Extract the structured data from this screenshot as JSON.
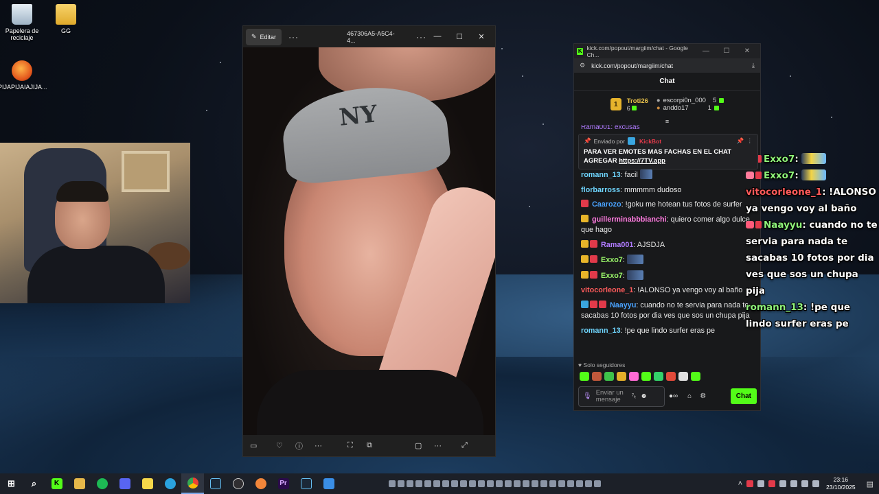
{
  "desktop": {
    "icons": [
      {
        "label": "Papelera de reciclaje",
        "icon": "recycle-bin-icon"
      },
      {
        "label": "GG",
        "icon": "folder-icon"
      },
      {
        "label": "PIJAPIJAIAJIJA...",
        "icon": "fl-studio-icon"
      }
    ]
  },
  "photos": {
    "edit_label": "Editar",
    "title": "467306A5-A5C4-4...",
    "controls": [
      "—",
      "☐",
      "✕"
    ],
    "bottom_icons": [
      "filmstrip-icon",
      "heart-icon",
      "info-icon",
      "more-icon",
      "crop-icon",
      "enhance-icon",
      "fit-icon",
      "more-icon",
      "expand-icon"
    ]
  },
  "chat_window": {
    "title": "kick.com/popout/margiim/chat - Google Ch...",
    "url": "kick.com/popout/margiim/chat",
    "header": "Chat",
    "leaderboard": {
      "first": {
        "name": "Troti26",
        "count": "6"
      },
      "second": {
        "name": "escorpi0n_000",
        "count": "5"
      },
      "third": {
        "name": "anddo17",
        "count": "1"
      }
    },
    "pinned": {
      "sent_by": "Enviado por",
      "bot": "KickBot",
      "text": "PARA VER EMOTES MAS FACHAS EN EL CHAT AGREGAR",
      "link": "https://7TV.app"
    },
    "partial_top": "Rama001: excusas",
    "messages": [
      {
        "user": "romann_13",
        "color": "#6fd6ff",
        "text": ": facil"
      },
      {
        "user": "florbarross",
        "color": "#6fd6ff",
        "text": ": mmmmm dudoso"
      },
      {
        "user": "Caarozo",
        "color": "#4aa3ff",
        "text": ": !goku me hotean tus fotos de surfer"
      },
      {
        "user": "guillerminabbbianchi",
        "color": "#ff7be0",
        "text": ": quiero comer algo dulce que hago"
      },
      {
        "user": "Rama001",
        "color": "#b07bff",
        "text": ": AJSDJA"
      },
      {
        "user": "Exxo7",
        "color": "#9bf76a",
        "text": ":"
      },
      {
        "user": "Exxo7",
        "color": "#9bf76a",
        "text": ":"
      },
      {
        "user": "vitocorleone_1",
        "color": "#ff5b5b",
        "text": ": !ALONSO ya vengo voy al baño"
      },
      {
        "user": "Naayyu",
        "color": "#4aa3ff",
        "text": ": cuando no te servia para nada te sacabas 10 fotos por dia ves que sos un chupa pija"
      },
      {
        "user": "romann_13",
        "color": "#6fd6ff",
        "text": ": !pe que lindo surfer eras pe"
      }
    ],
    "followers_only": "Solo seguidores",
    "input_placeholder": "Enviar un mensaje",
    "send_label": "Chat"
  },
  "overlay": [
    {
      "user": "Exxo7",
      "text": ":",
      "color": "#8ef27a"
    },
    {
      "user": "Exxo7",
      "text": ":",
      "color": "#8ef27a"
    },
    {
      "user": "vitocorleone_1",
      "text": ": !ALONSO ya vengo voy al baño",
      "color": "#ff5a5a"
    },
    {
      "user": "Naayyu",
      "text": ": cuando no te servia para nada te sacabas 10 fotos por dia ves que sos un chupa pija",
      "color": "#8ef27a"
    },
    {
      "user": "romann_13",
      "text": ": !pe que lindo surfer eras pe",
      "color": "#8ef27a"
    }
  ],
  "taskbar": {
    "time": "23:16",
    "date": "23/10/2025",
    "apps": [
      "windows-start-icon",
      "search-icon",
      "kick-icon",
      "file-explorer-icon",
      "spotify-icon",
      "discord-icon",
      "sticky-notes-icon",
      "telegram-icon",
      "chrome-icon",
      "steam-icon",
      "obs-icon",
      "fl-studio-icon",
      "premiere-icon",
      "steam-icon",
      "photos-icon"
    ]
  },
  "colors": {
    "kick_green": "#53fc18",
    "chat_bg": "#18191b"
  }
}
